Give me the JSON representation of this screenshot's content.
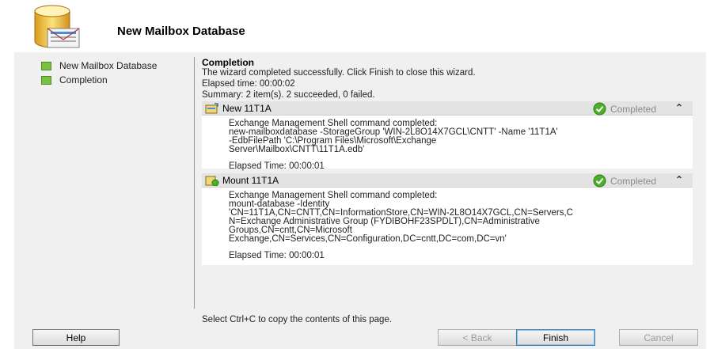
{
  "wizard": {
    "title": "New Mailbox Database"
  },
  "nav": {
    "items": [
      {
        "label": "New Mailbox Database"
      },
      {
        "label": "Completion"
      }
    ]
  },
  "content": {
    "heading": "Completion",
    "message": "The wizard completed successfully. Click Finish to close this wizard.",
    "elapsed": "Elapsed time: 00:00:02",
    "summary": "Summary: 2 item(s). 2 succeeded, 0 failed."
  },
  "tasks": [
    {
      "name": "New 11T1A",
      "status": "Completed",
      "lines": [
        "Exchange Management Shell command completed:",
        "new-mailboxdatabase -StorageGroup 'WIN-2L8O14X7GCL\\CNTT' -Name '11T1A'",
        "-EdbFilePath 'C:\\Program Files\\Microsoft\\Exchange",
        "Server\\Mailbox\\CNTT\\11T1A.edb'"
      ],
      "elapsed": "Elapsed Time: 00:00:01"
    },
    {
      "name": "Mount 11T1A",
      "status": "Completed",
      "lines": [
        "Exchange Management Shell command completed:",
        "mount-database -Identity",
        "'CN=11T1A,CN=CNTT,CN=InformationStore,CN=WIN-2L8O14X7GCL,CN=Servers,C",
        "N=Exchange Administrative Group (FYDIBOHF23SPDLT),CN=Administrative",
        "Groups,CN=cntt,CN=Microsoft",
        "Exchange,CN=Services,CN=Configuration,DC=cntt,DC=com,DC=vn'"
      ],
      "elapsed": "Elapsed Time: 00:00:01"
    }
  ],
  "footer": {
    "note": "Select Ctrl+C to copy the contents of this page."
  },
  "buttons": {
    "help": "Help",
    "back": "< Back",
    "finish": "Finish",
    "cancel": "Cancel"
  },
  "colors": {
    "nav_square": "#7ac142",
    "completed_check": "#4caf2a"
  }
}
